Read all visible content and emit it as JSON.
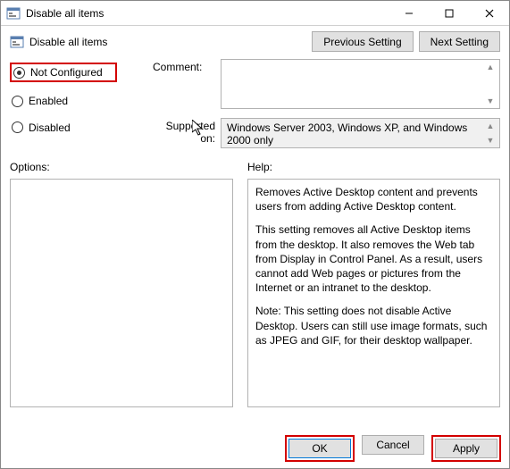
{
  "window": {
    "title": "Disable all items"
  },
  "header": {
    "title": "Disable all items",
    "prev_label": "Previous Setting",
    "next_label": "Next Setting"
  },
  "state": {
    "not_configured": "Not Configured",
    "enabled": "Enabled",
    "disabled": "Disabled",
    "selected": "not_configured"
  },
  "fields": {
    "comment_label": "Comment:",
    "comment_value": "",
    "supported_label": "Supported on:",
    "supported_value": "Windows Server 2003, Windows XP, and Windows 2000 only"
  },
  "labels": {
    "options": "Options:",
    "help": "Help:"
  },
  "help": {
    "p1": "Removes Active Desktop content and prevents users from adding Active Desktop content.",
    "p2": "This setting removes all Active Desktop items from the desktop. It also removes the Web tab from Display in Control Panel. As a result, users cannot add Web pages or  pictures from the Internet or an intranet to the desktop.",
    "p3": "Note: This setting does not disable Active Desktop. Users can  still use image formats, such as JPEG and GIF, for their desktop wallpaper."
  },
  "footer": {
    "ok": "OK",
    "cancel": "Cancel",
    "apply": "Apply"
  }
}
